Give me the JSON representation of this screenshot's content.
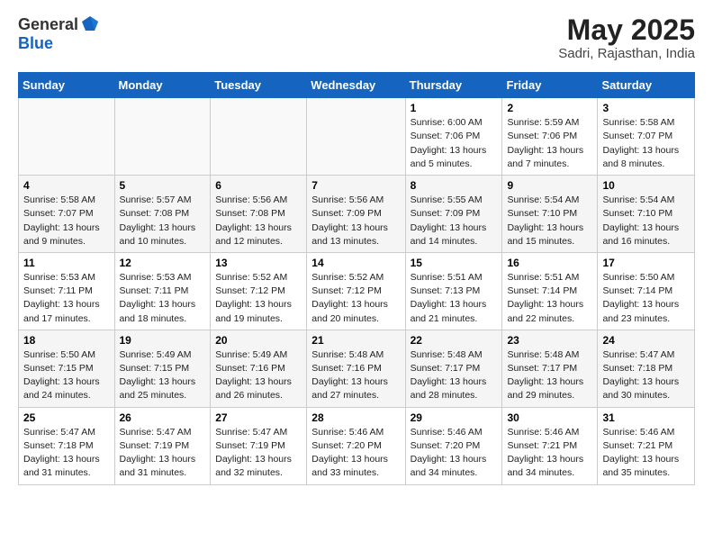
{
  "header": {
    "logo_general": "General",
    "logo_blue": "Blue",
    "month_title": "May 2025",
    "subtitle": "Sadri, Rajasthan, India"
  },
  "days_of_week": [
    "Sunday",
    "Monday",
    "Tuesday",
    "Wednesday",
    "Thursday",
    "Friday",
    "Saturday"
  ],
  "weeks": [
    {
      "row": 1,
      "cells": [
        {
          "day": "",
          "text": ""
        },
        {
          "day": "",
          "text": ""
        },
        {
          "day": "",
          "text": ""
        },
        {
          "day": "",
          "text": ""
        },
        {
          "day": "1",
          "text": "Sunrise: 6:00 AM\nSunset: 7:06 PM\nDaylight: 13 hours\nand 5 minutes."
        },
        {
          "day": "2",
          "text": "Sunrise: 5:59 AM\nSunset: 7:06 PM\nDaylight: 13 hours\nand 7 minutes."
        },
        {
          "day": "3",
          "text": "Sunrise: 5:58 AM\nSunset: 7:07 PM\nDaylight: 13 hours\nand 8 minutes."
        }
      ]
    },
    {
      "row": 2,
      "cells": [
        {
          "day": "4",
          "text": "Sunrise: 5:58 AM\nSunset: 7:07 PM\nDaylight: 13 hours\nand 9 minutes."
        },
        {
          "day": "5",
          "text": "Sunrise: 5:57 AM\nSunset: 7:08 PM\nDaylight: 13 hours\nand 10 minutes."
        },
        {
          "day": "6",
          "text": "Sunrise: 5:56 AM\nSunset: 7:08 PM\nDaylight: 13 hours\nand 12 minutes."
        },
        {
          "day": "7",
          "text": "Sunrise: 5:56 AM\nSunset: 7:09 PM\nDaylight: 13 hours\nand 13 minutes."
        },
        {
          "day": "8",
          "text": "Sunrise: 5:55 AM\nSunset: 7:09 PM\nDaylight: 13 hours\nand 14 minutes."
        },
        {
          "day": "9",
          "text": "Sunrise: 5:54 AM\nSunset: 7:10 PM\nDaylight: 13 hours\nand 15 minutes."
        },
        {
          "day": "10",
          "text": "Sunrise: 5:54 AM\nSunset: 7:10 PM\nDaylight: 13 hours\nand 16 minutes."
        }
      ]
    },
    {
      "row": 3,
      "cells": [
        {
          "day": "11",
          "text": "Sunrise: 5:53 AM\nSunset: 7:11 PM\nDaylight: 13 hours\nand 17 minutes."
        },
        {
          "day": "12",
          "text": "Sunrise: 5:53 AM\nSunset: 7:11 PM\nDaylight: 13 hours\nand 18 minutes."
        },
        {
          "day": "13",
          "text": "Sunrise: 5:52 AM\nSunset: 7:12 PM\nDaylight: 13 hours\nand 19 minutes."
        },
        {
          "day": "14",
          "text": "Sunrise: 5:52 AM\nSunset: 7:12 PM\nDaylight: 13 hours\nand 20 minutes."
        },
        {
          "day": "15",
          "text": "Sunrise: 5:51 AM\nSunset: 7:13 PM\nDaylight: 13 hours\nand 21 minutes."
        },
        {
          "day": "16",
          "text": "Sunrise: 5:51 AM\nSunset: 7:14 PM\nDaylight: 13 hours\nand 22 minutes."
        },
        {
          "day": "17",
          "text": "Sunrise: 5:50 AM\nSunset: 7:14 PM\nDaylight: 13 hours\nand 23 minutes."
        }
      ]
    },
    {
      "row": 4,
      "cells": [
        {
          "day": "18",
          "text": "Sunrise: 5:50 AM\nSunset: 7:15 PM\nDaylight: 13 hours\nand 24 minutes."
        },
        {
          "day": "19",
          "text": "Sunrise: 5:49 AM\nSunset: 7:15 PM\nDaylight: 13 hours\nand 25 minutes."
        },
        {
          "day": "20",
          "text": "Sunrise: 5:49 AM\nSunset: 7:16 PM\nDaylight: 13 hours\nand 26 minutes."
        },
        {
          "day": "21",
          "text": "Sunrise: 5:48 AM\nSunset: 7:16 PM\nDaylight: 13 hours\nand 27 minutes."
        },
        {
          "day": "22",
          "text": "Sunrise: 5:48 AM\nSunset: 7:17 PM\nDaylight: 13 hours\nand 28 minutes."
        },
        {
          "day": "23",
          "text": "Sunrise: 5:48 AM\nSunset: 7:17 PM\nDaylight: 13 hours\nand 29 minutes."
        },
        {
          "day": "24",
          "text": "Sunrise: 5:47 AM\nSunset: 7:18 PM\nDaylight: 13 hours\nand 30 minutes."
        }
      ]
    },
    {
      "row": 5,
      "cells": [
        {
          "day": "25",
          "text": "Sunrise: 5:47 AM\nSunset: 7:18 PM\nDaylight: 13 hours\nand 31 minutes."
        },
        {
          "day": "26",
          "text": "Sunrise: 5:47 AM\nSunset: 7:19 PM\nDaylight: 13 hours\nand 31 minutes."
        },
        {
          "day": "27",
          "text": "Sunrise: 5:47 AM\nSunset: 7:19 PM\nDaylight: 13 hours\nand 32 minutes."
        },
        {
          "day": "28",
          "text": "Sunrise: 5:46 AM\nSunset: 7:20 PM\nDaylight: 13 hours\nand 33 minutes."
        },
        {
          "day": "29",
          "text": "Sunrise: 5:46 AM\nSunset: 7:20 PM\nDaylight: 13 hours\nand 34 minutes."
        },
        {
          "day": "30",
          "text": "Sunrise: 5:46 AM\nSunset: 7:21 PM\nDaylight: 13 hours\nand 34 minutes."
        },
        {
          "day": "31",
          "text": "Sunrise: 5:46 AM\nSunset: 7:21 PM\nDaylight: 13 hours\nand 35 minutes."
        }
      ]
    }
  ]
}
